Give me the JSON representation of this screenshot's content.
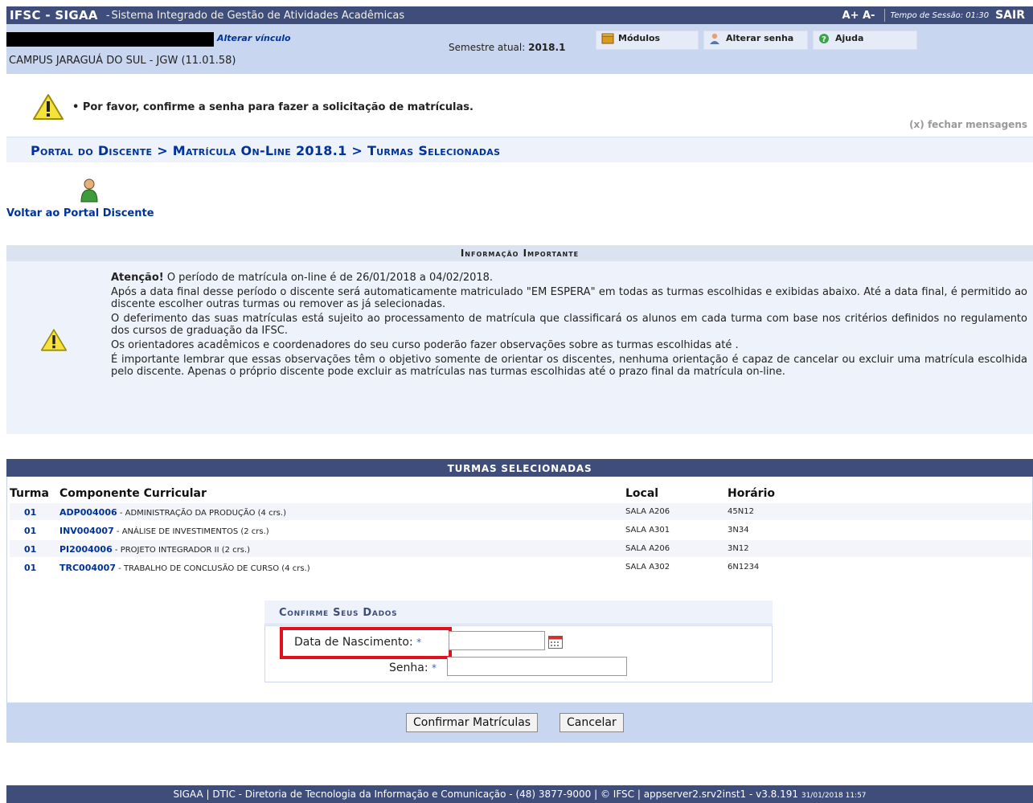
{
  "topbar": {
    "brand": "IFSC - SIGAA",
    "brand_sep": " - ",
    "system_name": "Sistema Integrado de Gestão de Atividades Acadêmicas",
    "font_controls": "A+  A-",
    "session_label": "Tempo de Sessão: 01:30",
    "logout": "SAIR"
  },
  "infobar": {
    "alterar_vinculo": "Alterar vínculo",
    "campus": "CAMPUS JARAGUÁ DO SUL - JGW (11.01.58)",
    "semester_label": "Semestre atual: ",
    "semester_value": "2018.1",
    "buttons": {
      "modulos": "Módulos",
      "alterar_senha": "Alterar senha",
      "ajuda": "Ajuda"
    }
  },
  "message": {
    "text": "• Por favor, confirme a senha para fazer a solicitação de matrículas.",
    "close": "(x) fechar mensagens"
  },
  "breadcrumb": "Portal do Discente > Matrícula On-Line 2018.1 > Turmas Selecionadas",
  "back_link": "Voltar ao Portal Discente",
  "important": {
    "title": "Informação Importante",
    "attention": "Atenção!",
    "p1_rest": " O período de matrícula on-line é de 26/01/2018 a 04/02/2018.",
    "p2": "Após a data final desse período o discente será automaticamente matriculado \"EM ESPERA\" em todas as turmas escolhidas e exibidas abaixo. Até a data final, é permitido ao discente escolher outras turmas ou remover as já selecionadas.",
    "p3": "O deferimento das suas matrículas está sujeito ao processamento de matrícula que classificará os alunos em cada turma com base nos critérios definidos no regulamento dos cursos de graduação da IFSC.",
    "p4": "Os orientadores acadêmicos e coordenadores do seu curso poderão fazer observações sobre as turmas escolhidas até .",
    "p5": "É importante lembrar que essas observações têm o objetivo somente de orientar os discentes, nenhuma orientação é capaz de cancelar ou excluir uma matrícula escolhida pelo discente. Apenas o próprio discente pode excluir as matrículas nas turmas escolhidas até o prazo final da matrícula on-line."
  },
  "turmas": {
    "title": "TURMAS SELECIONADAS",
    "headers": {
      "turma": "Turma",
      "componente": "Componente Curricular",
      "local": "Local",
      "horario": "Horário"
    },
    "rows": [
      {
        "turma": "01",
        "code": "ADP004006",
        "name": " - ADMINISTRAÇÃO DA PRODUÇÃO (4 crs.)",
        "local": "SALA A206",
        "horario": "45N12"
      },
      {
        "turma": "01",
        "code": "INV004007",
        "name": " - ANÁLISE DE INVESTIMENTOS (2 crs.)",
        "local": "SALA A301",
        "horario": "3N34"
      },
      {
        "turma": "01",
        "code": "PI2004006",
        "name": " - PROJETO INTEGRADOR II (2 crs.)",
        "local": "SALA A206",
        "horario": "3N12"
      },
      {
        "turma": "01",
        "code": "TRC004007",
        "name": " - TRABALHO DE CONCLUSÃO DE CURSO (4 crs.)",
        "local": "SALA A302",
        "horario": "6N1234"
      }
    ]
  },
  "form": {
    "title": "Confirme Seus Dados",
    "birth_label": "Data de Nascimento:",
    "birth_value": "",
    "password_label": "Senha:",
    "password_value": "",
    "required_mark": "*"
  },
  "buttons": {
    "confirm": "Confirmar Matrículas",
    "cancel": "Cancelar"
  },
  "footer": {
    "text": "SIGAA | DTIC - Diretoria de Tecnologia da Informação e Comunicação - (48) 3877-9000 | © IFSC | appserver2.srv2inst1 - v3.8.191 ",
    "timestamp": "31/01/2018 11:57"
  },
  "colors": {
    "header": "#3f4d7a",
    "bar": "#c8d7ef",
    "link": "#003399",
    "highlight": "#e0101c"
  }
}
